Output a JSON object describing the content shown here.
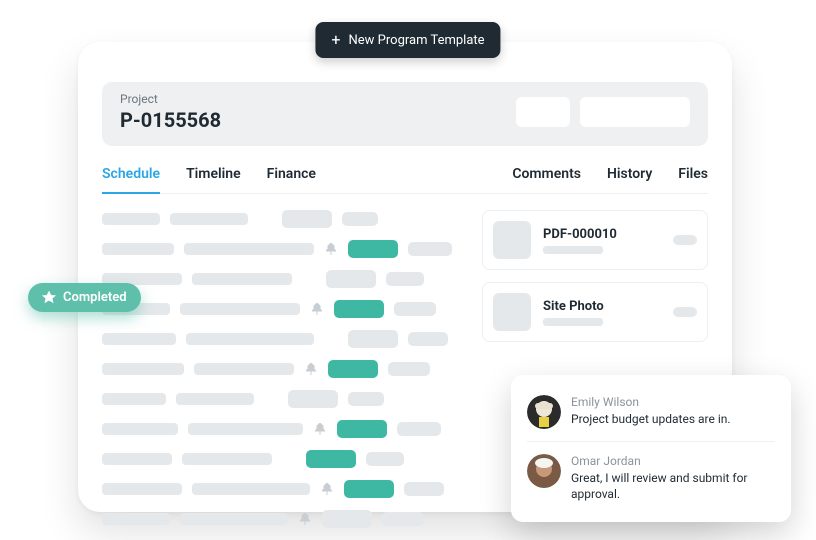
{
  "newProgramButton": "New Program Template",
  "header": {
    "label": "Project",
    "id": "P-0155568"
  },
  "tabs": {
    "left": [
      "Schedule",
      "Timeline",
      "Finance"
    ],
    "right": [
      "Comments",
      "History",
      "Files"
    ],
    "active": "Schedule"
  },
  "scheduleRows": [
    {
      "c1w": 58,
      "c2w": 78,
      "pin": false,
      "teal": false,
      "c4w": 36
    },
    {
      "c1w": 72,
      "c2w": 130,
      "pin": true,
      "teal": true,
      "c4w": 44
    },
    {
      "c1w": 80,
      "c2w": 100,
      "pin": false,
      "teal": false,
      "c4w": 38
    },
    {
      "c1w": 68,
      "c2w": 120,
      "pin": true,
      "teal": true,
      "c4w": 42
    },
    {
      "c1w": 74,
      "c2w": 128,
      "pin": false,
      "teal": false,
      "c4w": 40
    },
    {
      "c1w": 82,
      "c2w": 100,
      "pin": true,
      "teal": true,
      "c4w": 42
    },
    {
      "c1w": 64,
      "c2w": 78,
      "pin": false,
      "teal": false,
      "c4w": 36
    },
    {
      "c1w": 76,
      "c2w": 115,
      "pin": true,
      "teal": true,
      "c4w": 44
    },
    {
      "c1w": 70,
      "c2w": 90,
      "pin": false,
      "teal": true,
      "c4w": 38
    },
    {
      "c1w": 80,
      "c2w": 118,
      "pin": true,
      "teal": true,
      "c4w": 40
    },
    {
      "c1w": 68,
      "c2w": 108,
      "pin": true,
      "teal": false,
      "c4w": 42
    }
  ],
  "files": [
    {
      "title": "PDF-000010"
    },
    {
      "title": "Site Photo"
    }
  ],
  "completedBadge": "Completed",
  "comments": [
    {
      "author": "Emily Wilson",
      "msg": "Project budget updates are in."
    },
    {
      "author": "Omar Jordan",
      "msg": "Great, I will review and submit for approval."
    }
  ]
}
